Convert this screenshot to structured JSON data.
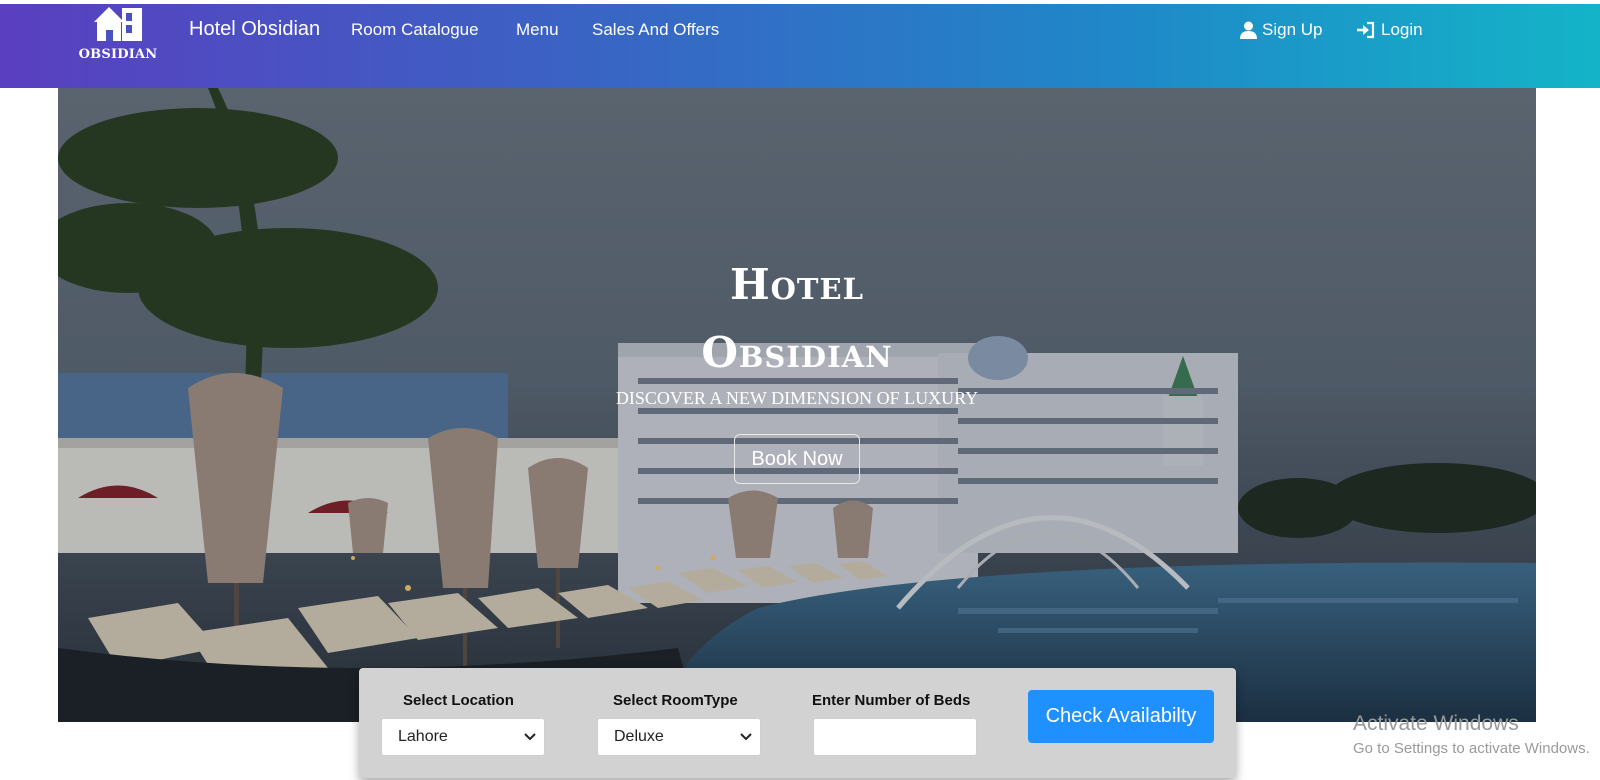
{
  "navbar": {
    "brand_text": "OBSIDIAN",
    "title": "Hotel Obsidian",
    "links": [
      "Room Catalogue",
      "Menu",
      "Sales And Offers"
    ],
    "signup": "Sign Up",
    "login": "Login",
    "icons": {
      "brand": "house-logo-icon",
      "signup": "user-icon",
      "login": "sign-in-icon"
    }
  },
  "hero": {
    "title_line1": "Hotel",
    "title_line2": "Obsidian",
    "subtitle": "Discover a new dimension of luxury",
    "book_button": "Book Now"
  },
  "search": {
    "location_label": "Select Location",
    "location_value": "Lahore",
    "roomtype_label": "Select RoomType",
    "roomtype_value": "Deluxe",
    "beds_label": "Enter Number of Beds",
    "beds_value": "",
    "check_button": "Check Availabilty"
  },
  "watermark": {
    "line1": "Activate Windows",
    "line2": "Go to Settings to activate Windows."
  },
  "colors": {
    "nav_gradient_start": "#5a3fc0",
    "nav_gradient_end": "#14b4c8",
    "button_primary": "#1e90ff",
    "panel_bg": "#d2d2d2"
  }
}
